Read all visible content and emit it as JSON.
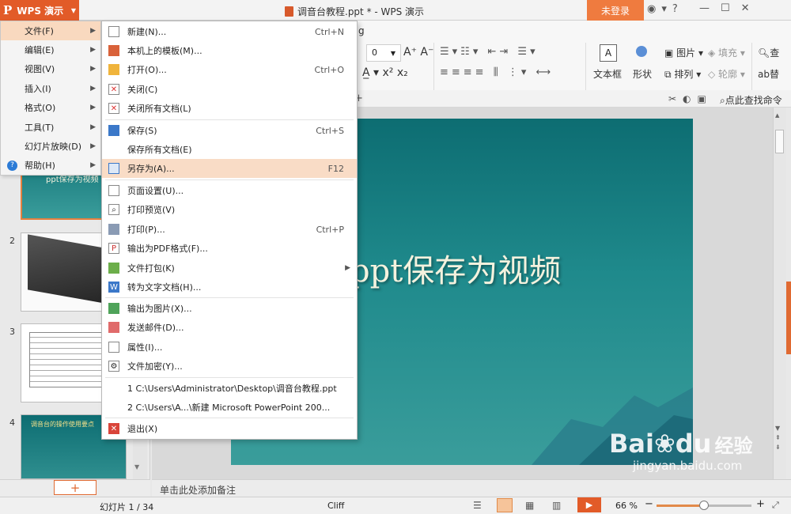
{
  "app": {
    "name": "WPS 演示",
    "logo": "P"
  },
  "title": {
    "text": "调音台教程.ppt * - WPS 演示"
  },
  "login_button": "未登录",
  "titlebar_icons": [
    "skin-icon",
    "shirt-icon",
    "help-icon",
    "minimize-icon",
    "restore-icon",
    "close-icon"
  ],
  "ribbon": {
    "font_size_value": "0",
    "partial_tab": "g",
    "groups": {
      "textbox": "文本框",
      "shape": "形状",
      "picture": "图片",
      "fill": "填充",
      "arrange": "排列",
      "outline": "轮廓",
      "find": "查",
      "replace": "替"
    },
    "find_cmd": "点此查找命令"
  },
  "main_menu": {
    "items": [
      {
        "label": "文件(F)",
        "active": true,
        "has_sub": true
      },
      {
        "label": "编辑(E)",
        "has_sub": true
      },
      {
        "label": "视图(V)",
        "has_sub": true
      },
      {
        "label": "插入(I)",
        "has_sub": true
      },
      {
        "label": "格式(O)",
        "has_sub": true
      },
      {
        "label": "工具(T)",
        "has_sub": true
      },
      {
        "label": "幻灯片放映(D)",
        "has_sub": true
      },
      {
        "label": "帮助(H)",
        "has_sub": true
      }
    ]
  },
  "file_menu": {
    "items": [
      {
        "label": "新建(N)...",
        "shortcut": "Ctrl+N",
        "icon": "new-icon"
      },
      {
        "label": "本机上的模板(M)...",
        "shortcut": "",
        "icon": "template-icon"
      },
      {
        "label": "打开(O)...",
        "shortcut": "Ctrl+O",
        "icon": "open-folder-icon"
      },
      {
        "label": "关闭(C)",
        "shortcut": "",
        "icon": "close-doc-icon"
      },
      {
        "label": "关闭所有文档(L)",
        "shortcut": "",
        "icon": "close-all-icon"
      },
      {
        "label": "保存(S)",
        "shortcut": "Ctrl+S",
        "icon": "save-icon"
      },
      {
        "label": "保存所有文档(E)",
        "shortcut": "",
        "icon": ""
      },
      {
        "label": "另存为(A)...",
        "shortcut": "F12",
        "icon": "save-as-icon",
        "highlight": true
      },
      {
        "label": "页面设置(U)...",
        "shortcut": "",
        "icon": "page-setup-icon"
      },
      {
        "label": "打印预览(V)",
        "shortcut": "",
        "icon": "print-preview-icon"
      },
      {
        "label": "打印(P)...",
        "shortcut": "Ctrl+P",
        "icon": "print-icon"
      },
      {
        "label": "输出为PDF格式(F)...",
        "shortcut": "",
        "icon": "pdf-icon"
      },
      {
        "label": "文件打包(K)",
        "shortcut": "",
        "icon": "package-icon",
        "has_sub": true
      },
      {
        "label": "转为文字文档(H)...",
        "shortcut": "",
        "icon": "to-word-icon"
      },
      {
        "label": "输出为图片(X)...",
        "shortcut": "",
        "icon": "export-image-icon"
      },
      {
        "label": "发送邮件(D)...",
        "shortcut": "",
        "icon": "mail-icon"
      },
      {
        "label": "属性(I)...",
        "shortcut": "",
        "icon": "properties-icon"
      },
      {
        "label": "文件加密(Y)...",
        "shortcut": "",
        "icon": "encrypt-icon"
      },
      {
        "label": "1 C:\\Users\\Administrator\\Desktop\\调音台教程.ppt",
        "shortcut": "",
        "icon": ""
      },
      {
        "label": "2 C:\\Users\\A...\\新建 Microsoft PowerPoint 200...",
        "shortcut": "",
        "icon": ""
      },
      {
        "label": "退出(X)",
        "shortcut": "",
        "icon": "exit-icon"
      }
    ]
  },
  "thumbnails": [
    {
      "number": "",
      "caption": "ppt保存为视频"
    },
    {
      "number": "2"
    },
    {
      "number": "3"
    },
    {
      "number": "4",
      "caption": "调音台的操作使用要点"
    }
  ],
  "slide": {
    "title": "ppt保存为视频"
  },
  "notes_placeholder": "单击此处添加备注",
  "status": {
    "slide_info": "幻灯片 1 / 34",
    "theme": "Cliff",
    "zoom": "66 %",
    "zoom_level": 0.5
  },
  "watermark": {
    "brand": "Bai",
    "brand2": "du",
    "cn": "经验",
    "url": "jingyan.baidu.com"
  }
}
